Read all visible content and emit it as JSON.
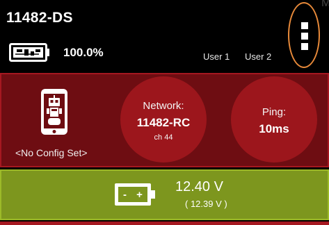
{
  "header": {
    "device_name": "11482-DS",
    "phone_battery_pct": "100.0%",
    "users": [
      "User 1",
      "User 2"
    ],
    "corner_mark": "M"
  },
  "status": {
    "config": "<No Config Set>",
    "network_title": "Network:",
    "network_name": "11482-RC",
    "network_channel": "ch 44",
    "ping_title": "Ping:",
    "ping_value": "10ms"
  },
  "robot_battery": {
    "voltage": "12.40 V",
    "voltage_secondary": "( 12.39 V )",
    "minus_sign": "-",
    "plus_sign": "+"
  },
  "colors": {
    "status_panel": "#6e0d12",
    "circle": "#9c161c",
    "battery_panel": "#7d961e",
    "menu_highlight": "#e88a3a"
  },
  "icons": {
    "phone_battery": "phone-battery-icon",
    "robot_phone": "robot-phone-icon",
    "robot_battery": "robot-battery-icon",
    "menu": "overflow-menu-icon"
  }
}
